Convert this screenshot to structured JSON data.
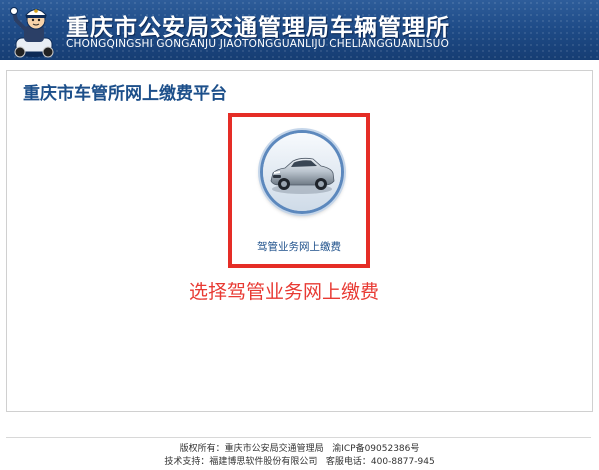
{
  "header": {
    "title_cn": "重庆市公安局交通管理局车辆管理所",
    "title_en": "CHONGQINGSHI GONGANJU JIAOTONGGUANLIJU CHELIANGGUANLISUO"
  },
  "panel": {
    "title": "重庆市车管所网上缴费平台",
    "tile": {
      "label": "驾管业务网上缴费",
      "icon": "car-photo-icon"
    },
    "hint": "选择驾管业务网上缴费"
  },
  "footer": {
    "copyright": "版权所有：重庆市公安局交通管理局",
    "icp": "渝ICP备09052386号",
    "support": "技术支持：福建博思软件股份有限公司",
    "service": "客服电话：400-8877-945"
  },
  "colors": {
    "header_bg": "#1f4c88",
    "title_text": "#1c4f8a",
    "highlight": "#e52d26"
  }
}
